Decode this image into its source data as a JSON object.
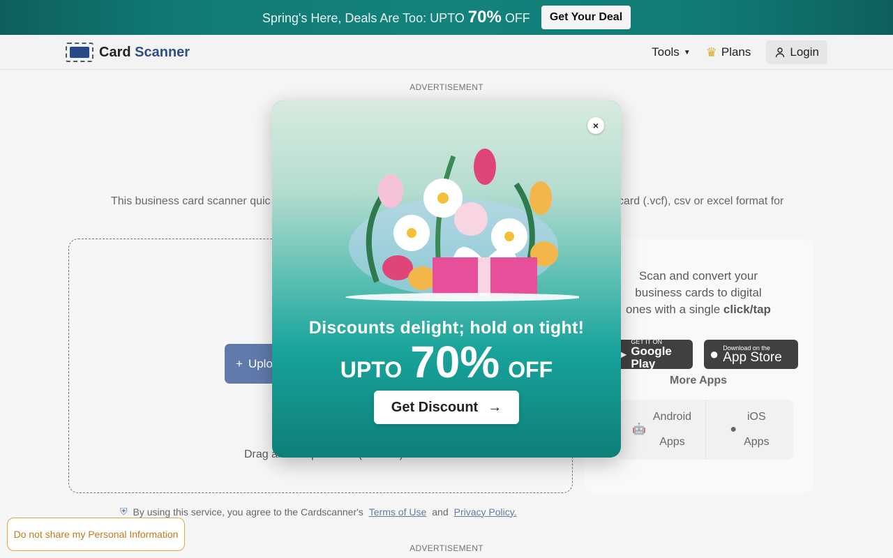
{
  "promo": {
    "text_before": "Spring's Here, Deals Are Too: UPTO ",
    "percent": "70%",
    "text_after": " OFF",
    "button": "Get Your Deal"
  },
  "header": {
    "logo_part1": "Card",
    "logo_part2": "Scanner",
    "nav": {
      "tools": "Tools",
      "plans": "Plans",
      "login": "Login"
    }
  },
  "page": {
    "ad_label": "ADVERTISEMENT",
    "intro_left": "This business card scanner quic",
    "intro_right": "card (.vcf), csv or excel format for",
    "upload_label": "Uplo",
    "drag_text": "Drag and Drop / Paste (Ctrl + V)",
    "side": {
      "title_1": "Scan and convert your",
      "title_2": "business cards to digital",
      "title_3": "ones with a single ",
      "title_bold": "click/tap",
      "google_small": "GET IT ON",
      "google_big": "Google Play",
      "apple_small": "Download on the",
      "apple_big": "App Store",
      "more_apps": "More Apps",
      "android_1": "Android",
      "android_2": "Apps",
      "ios_1": "iOS",
      "ios_2": "Apps"
    },
    "terms_text": "By using this service, you agree to the Cardscanner's",
    "terms_link": "Terms of Use",
    "terms_and": "and",
    "privacy_link": "Privacy Policy."
  },
  "modal": {
    "close": "×",
    "headline": "Discounts delight; hold on tight!",
    "offer_prefix": "UPTO",
    "offer_percent": "70%",
    "offer_suffix": "OFF",
    "cta": "Get Discount",
    "cta_arrow": "→"
  },
  "privacy_button": "Do not share my Personal Information",
  "icons": {
    "close": "close-icon",
    "arrow": "arrow-right-icon",
    "plus": "plus-icon",
    "user": "user-icon",
    "shield": "shield-icon",
    "android": "android-icon",
    "apple": "apple-icon",
    "play": "google-play-icon",
    "plans": "crown-icon"
  },
  "colors": {
    "brand": "#2c4f8a",
    "promo_bg": "#117a74",
    "modal_teal": "#15958f",
    "privacy_accent": "#c27b1a"
  }
}
